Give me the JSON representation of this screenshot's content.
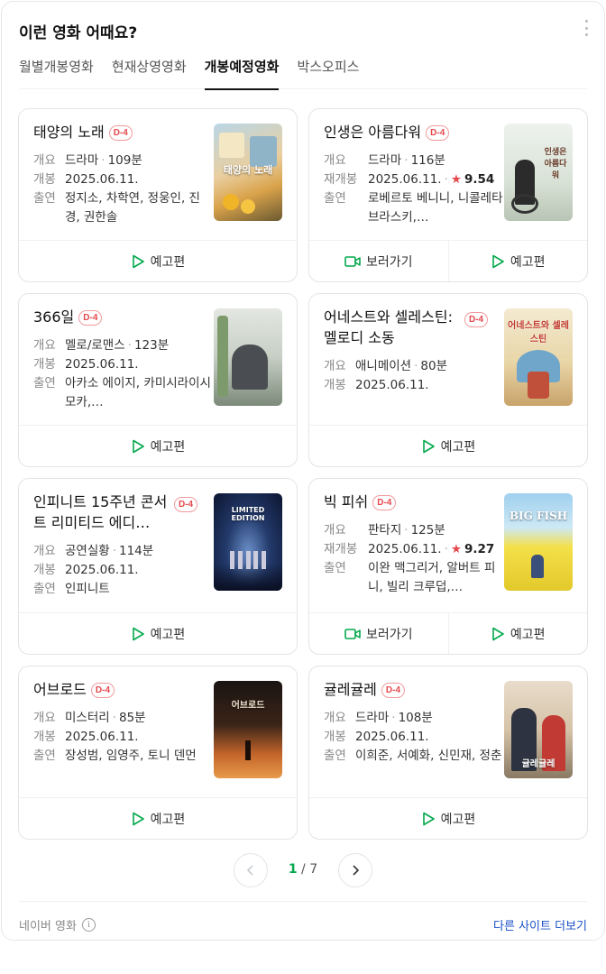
{
  "title": "이런 영화 어때요?",
  "tabs": [
    {
      "label": "월별개봉영화",
      "active": false
    },
    {
      "label": "현재상영영화",
      "active": false
    },
    {
      "label": "개봉예정영화",
      "active": true
    },
    {
      "label": "박스오피스",
      "active": false
    }
  ],
  "labels": {
    "genre": "개요",
    "release": "개봉",
    "rerelease": "재개봉",
    "cast": "출연"
  },
  "actions": {
    "trailer": "예고편",
    "watch": "보러가기"
  },
  "movies": [
    {
      "title": "태양의 노래",
      "badge": "D-4",
      "genre": "드라마",
      "runtime": "109분",
      "release": "2025.06.11.",
      "cast": "정지소, 차학연, 정웅인, 진경, 권한솔",
      "poster_caption": "태양의 노래"
    },
    {
      "title": "인생은 아름다워",
      "badge": "D-4",
      "genre": "드라마",
      "runtime": "116분",
      "release": "2025.06.11.",
      "rating": "9.54",
      "cast": "로베르토 베니니, 니콜레타 브라스키,…",
      "poster_caption": "인생은 아름다워"
    },
    {
      "title": "366일",
      "badge": "D-4",
      "genre": "멜로/로맨스",
      "runtime": "123분",
      "release": "2025.06.11.",
      "cast": "아카소 에이지, 카미시라이시 모카,…",
      "poster_caption": ""
    },
    {
      "title": "어네스트와 셀레스틴: 멜로디 소동",
      "badge": "D-4",
      "genre": "애니메이션",
      "runtime": "80분",
      "release": "2025.06.11.",
      "poster_caption": "어네스트와 셀레스틴"
    },
    {
      "title": "인피니트 15주년 콘서트 리미티드 에디…",
      "badge": "D-4",
      "genre": "공연실황",
      "runtime": "114분",
      "release": "2025.06.11.",
      "cast": "인피니트",
      "poster_caption": "LIMITED EDITION"
    },
    {
      "title": "빅 피쉬",
      "badge": "D-4",
      "genre": "판타지",
      "runtime": "125분",
      "release": "2025.06.11.",
      "rating": "9.27",
      "cast": "이완 맥그리거, 알버트 피니, 빌리 크루덥,…",
      "poster_caption": "BIG FISH"
    },
    {
      "title": "어브로드",
      "badge": "D-4",
      "genre": "미스터리",
      "runtime": "85분",
      "release": "2025.06.11.",
      "cast": "장성범, 임영주, 토니 덴먼",
      "poster_caption": "어브로드"
    },
    {
      "title": "귤레귤레",
      "badge": "D-4",
      "genre": "드라마",
      "runtime": "108분",
      "release": "2025.06.11.",
      "cast": "이희준, 서예화, 신민재, 정춘",
      "poster_caption": "귤레귤레"
    }
  ],
  "pagination": {
    "current": "1",
    "separator": "/",
    "total": "7"
  },
  "footer": {
    "source": "네이버 영화",
    "more": "다른 사이트 더보기"
  },
  "colors": {
    "accent_green": "#03a94d",
    "badge_red": "#e5484d",
    "link_blue": "#1a50c8"
  }
}
